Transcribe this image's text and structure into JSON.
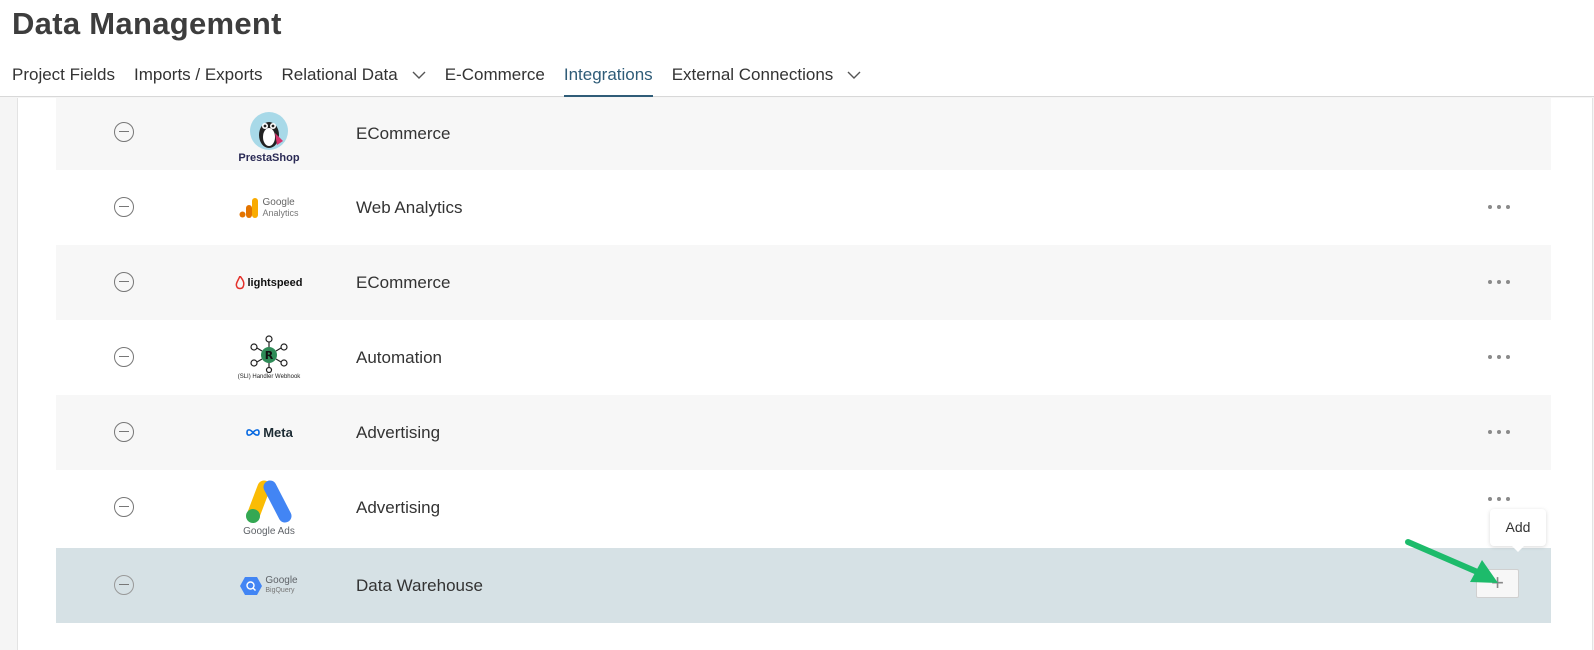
{
  "page": {
    "title": "Data Management"
  },
  "tabs": [
    {
      "label": "Project Fields",
      "has_dropdown": false,
      "active": false
    },
    {
      "label": "Imports / Exports",
      "has_dropdown": false,
      "active": false
    },
    {
      "label": "Relational Data",
      "has_dropdown": true,
      "active": false
    },
    {
      "label": "E-Commerce",
      "has_dropdown": false,
      "active": false
    },
    {
      "label": "Integrations",
      "has_dropdown": false,
      "active": true
    },
    {
      "label": "External Connections",
      "has_dropdown": true,
      "active": false
    }
  ],
  "integrations": [
    {
      "logo": "prestashop-logo",
      "logo_text": "PrestaShop",
      "category": "ECommerce",
      "actions": "none"
    },
    {
      "logo": "google-analytics-logo",
      "logo_text": [
        "Google",
        "Analytics"
      ],
      "category": "Web Analytics",
      "actions": "more"
    },
    {
      "logo": "lightspeed-logo",
      "logo_text": "lightspeed",
      "category": "ECommerce",
      "actions": "more"
    },
    {
      "logo": "handler-webhook-logo",
      "logo_text": "(SLI) Handler Webhook",
      "category": "Automation",
      "actions": "more"
    },
    {
      "logo": "meta-logo",
      "logo_text": "Meta",
      "category": "Advertising",
      "actions": "more"
    },
    {
      "logo": "google-ads-logo",
      "logo_text": "Google Ads",
      "category": "Advertising",
      "actions": "more"
    },
    {
      "logo": "google-bigquery-logo",
      "logo_text": [
        "Google",
        "BigQuery"
      ],
      "category": "Data Warehouse",
      "actions": "add"
    }
  ],
  "tooltip": {
    "label": "Add"
  },
  "add_button": {
    "symbol": "+"
  },
  "colors": {
    "accent": "#2f5c78",
    "highlight_row": "#d6e1e5",
    "shaded_row": "#f7f7f7",
    "arrow": "#1dbb6b"
  }
}
